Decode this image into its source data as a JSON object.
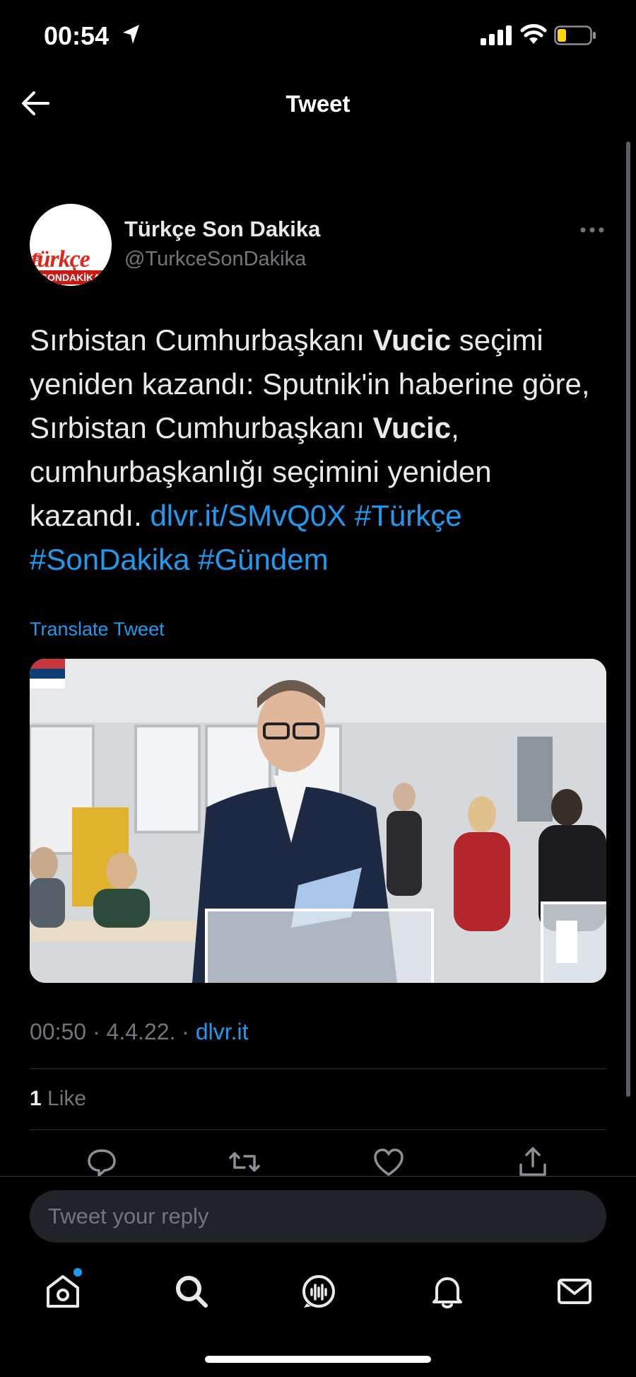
{
  "status_bar": {
    "time": "00:54"
  },
  "header": {
    "title": "Tweet"
  },
  "author": {
    "name": "Türkçe Son Dakika",
    "handle": "@TurkceSonDakika",
    "avatar_text": {
      "at": "@",
      "main": "türkçe",
      "sub": "SONDAKİKA"
    }
  },
  "tweet": {
    "text_parts": {
      "p1": "Sırbistan Cumhurbaşkanı ",
      "b1": "Vucic",
      "p2": " seçimi yeniden kazandı: Sputnik'in haberine göre, Sırbistan Cumhurbaşkanı ",
      "b2": "Vucic",
      "p3": ", cumhurbaşkanlığı seçimini yeniden kazandı. ",
      "link": "dlvr.it/SMvQ0X",
      "tag1": "#Türkçe",
      "tag2": "#SonDakika",
      "tag3": "#Gündem"
    },
    "translate_label": "Translate Tweet",
    "time": "00:50",
    "date": "4.4.22.",
    "separator": " · ",
    "source": "dlvr.it",
    "likes_count": "1",
    "likes_label": "Like"
  },
  "reply": {
    "placeholder": "Tweet your reply"
  },
  "colors": {
    "accent": "#1d9bf0",
    "background": "#000000",
    "muted": "#71767b"
  }
}
